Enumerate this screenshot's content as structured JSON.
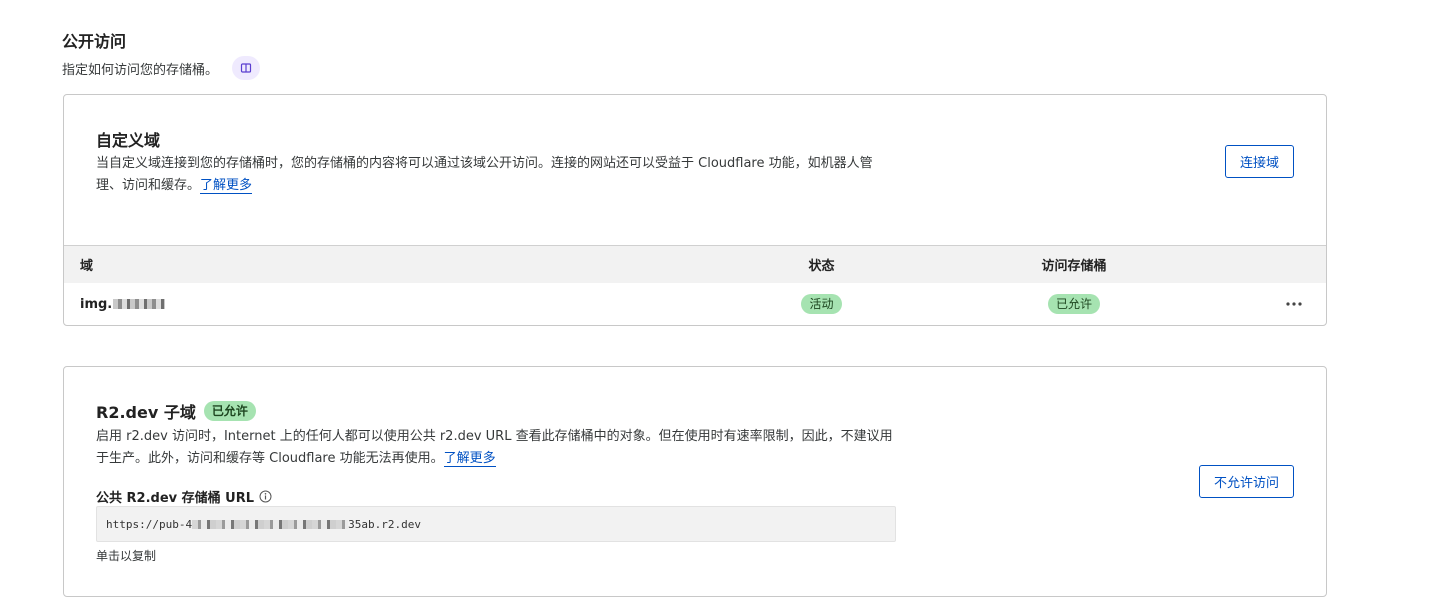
{
  "public_access": {
    "title": "公开访问",
    "description": "指定如何访问您的存储桶。",
    "doc_icon": "book-icon"
  },
  "custom_domain": {
    "title": "自定义域",
    "description": "当自定义域连接到您的存储桶时，您的存储桶的内容将可以通过该域公开访问。连接的网站还可以受益于 Cloudflare 功能，如机器人管理、访问和缓存。",
    "learn_more": "了解更多",
    "connect_button": "连接域",
    "table": {
      "headers": {
        "domain": "域",
        "status": "状态",
        "access": "访问存储桶"
      },
      "rows": [
        {
          "domain": "img.",
          "status": "活动",
          "access": "已允许"
        }
      ]
    },
    "row_menu_icon": "more-horizontal-icon"
  },
  "r2dev": {
    "title": "R2.dev 子域",
    "badge": "已允许",
    "description": "启用 r2.dev 访问时，Internet 上的任何人都可以使用公共 r2.dev URL 查看此存储桶中的对象。但在使用时有速率限制，因此，不建议用于生产。此外，访问和缓存等 Cloudflare 功能无法再使用。",
    "learn_more": "了解更多",
    "disallow_button": "不允许访问",
    "url_label": "公共 R2.dev 存储桶 URL",
    "url_prefix": "https://pub-4",
    "url_suffix": "35ab.r2.dev",
    "copy_hint": "单击以复制",
    "info_icon": "info-icon"
  },
  "colors": {
    "accent": "#0051c3",
    "badge_bg": "#a6e3b1",
    "border": "#c8c8c8"
  }
}
